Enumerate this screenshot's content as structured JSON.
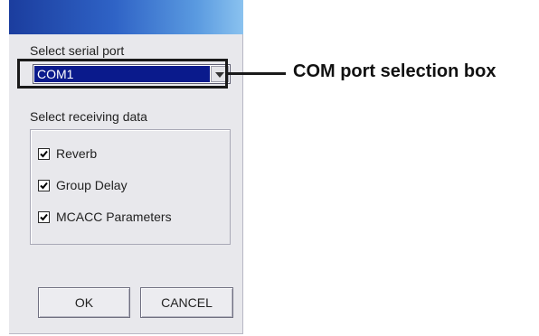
{
  "dialog": {
    "serial_port_label": "Select serial port",
    "serial_port": {
      "selected": "COM1"
    },
    "receiving_label": "Select receiving data",
    "options": [
      {
        "label": "Reverb",
        "checked": true
      },
      {
        "label": "Group Delay",
        "checked": true
      },
      {
        "label": "MCACC Parameters",
        "checked": true
      }
    ],
    "buttons": {
      "ok": "OK",
      "cancel": "CANCEL"
    }
  },
  "callout": {
    "text": "COM port selection box"
  },
  "colors": {
    "title_gradient_start": "#1b3d9e",
    "title_gradient_end": "#8ac2ef",
    "selection": "#0a1a8c",
    "dialog_bg": "#e8e8ec"
  }
}
